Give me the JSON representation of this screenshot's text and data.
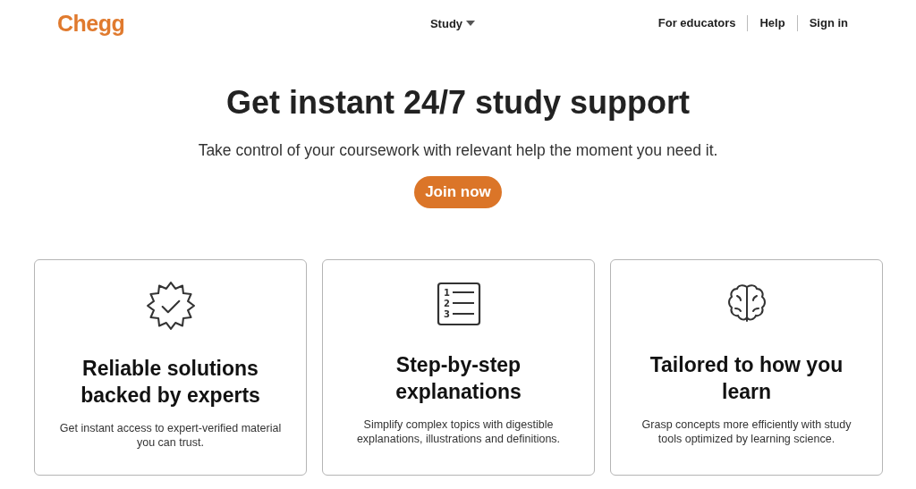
{
  "header": {
    "logo": "Chegg",
    "nav_center": {
      "label": "Study",
      "expanded": false
    },
    "nav_right": [
      "For educators",
      "Help",
      "Sign in"
    ]
  },
  "hero": {
    "title": "Get instant 24/7 study support",
    "subtitle": "Take control of your coursework with relevant help the moment you need it.",
    "button": "Join now"
  },
  "cards": [
    {
      "kind": "badge",
      "title": "Reliable solutions backed by experts",
      "text": "Get instant access to expert-verified material you can trust."
    },
    {
      "kind": "list",
      "icon_labels": [
        "1",
        "2",
        "3"
      ],
      "title": "Step-by-step explanations",
      "text": "Simplify complex topics with digestible explanations, illustrations and definitions."
    },
    {
      "kind": "brain",
      "title": "Tailored to how you learn",
      "text": "Grasp concepts more efficiently with study tools optimized by learning science."
    }
  ]
}
